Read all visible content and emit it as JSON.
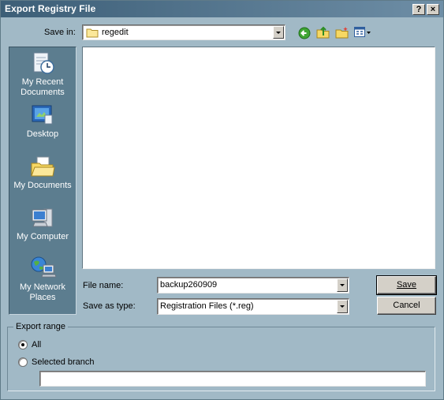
{
  "window": {
    "title": "Export Registry File",
    "help_label": "?",
    "close_label": "×"
  },
  "toolbar": {
    "save_in_label": "Save in:",
    "save_in_value": "regedit"
  },
  "places": [
    {
      "label": "My Recent Documents",
      "icon": "recent-documents-icon"
    },
    {
      "label": "Desktop",
      "icon": "desktop-icon"
    },
    {
      "label": "My Documents",
      "icon": "my-documents-icon"
    },
    {
      "label": "My Computer",
      "icon": "my-computer-icon"
    },
    {
      "label": "My Network Places",
      "icon": "network-places-icon"
    }
  ],
  "form": {
    "file_name_label": "File name:",
    "file_name_value": "backup260909",
    "save_as_type_label": "Save as type:",
    "save_as_type_value": "Registration Files (*.reg)",
    "save_button": "Save",
    "cancel_button": "Cancel"
  },
  "export_range": {
    "title": "Export range",
    "all_label": "All",
    "selected_branch_label": "Selected branch",
    "selected": "All",
    "branch_value": ""
  }
}
